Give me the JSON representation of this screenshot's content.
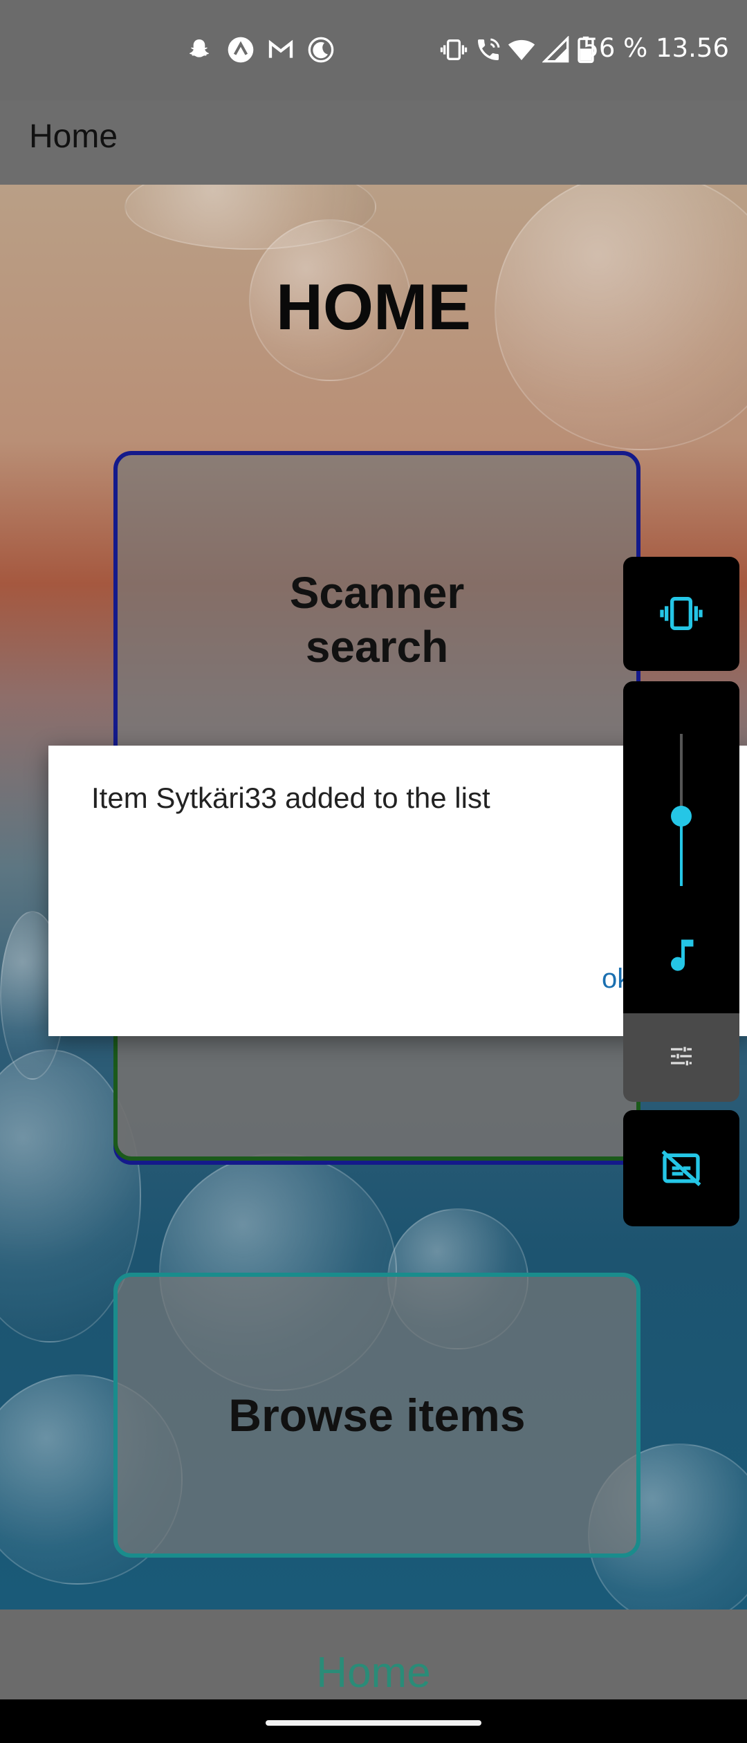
{
  "status_bar": {
    "left_icons": [
      "snapchat-icon",
      "app-launcher-icon",
      "gmail-icon",
      "do-not-disturb-icon"
    ],
    "right_icons": [
      "vibrate-icon",
      "wifi-calling-icon",
      "wifi-icon",
      "cellular-signal-icon",
      "battery-icon"
    ],
    "battery_and_time": "56 % 13.56"
  },
  "app_bar": {
    "title": "Home"
  },
  "main": {
    "heading": "HOME",
    "cards": {
      "scanner_search": "Scanner\nsearch",
      "browse_items": "Browse items"
    }
  },
  "dialog": {
    "message": "Item Sytkäri33 added to the list",
    "ok_button_visible_text": "ok"
  },
  "bottom_nav": {
    "label": "Home"
  },
  "volume_panel": {
    "level_fraction": 0.46,
    "accent_color": "#25c6e6",
    "icons": [
      "vibrate-mode-icon",
      "music-note-icon",
      "equalizer-settings-icon",
      "captions-off-icon"
    ]
  }
}
